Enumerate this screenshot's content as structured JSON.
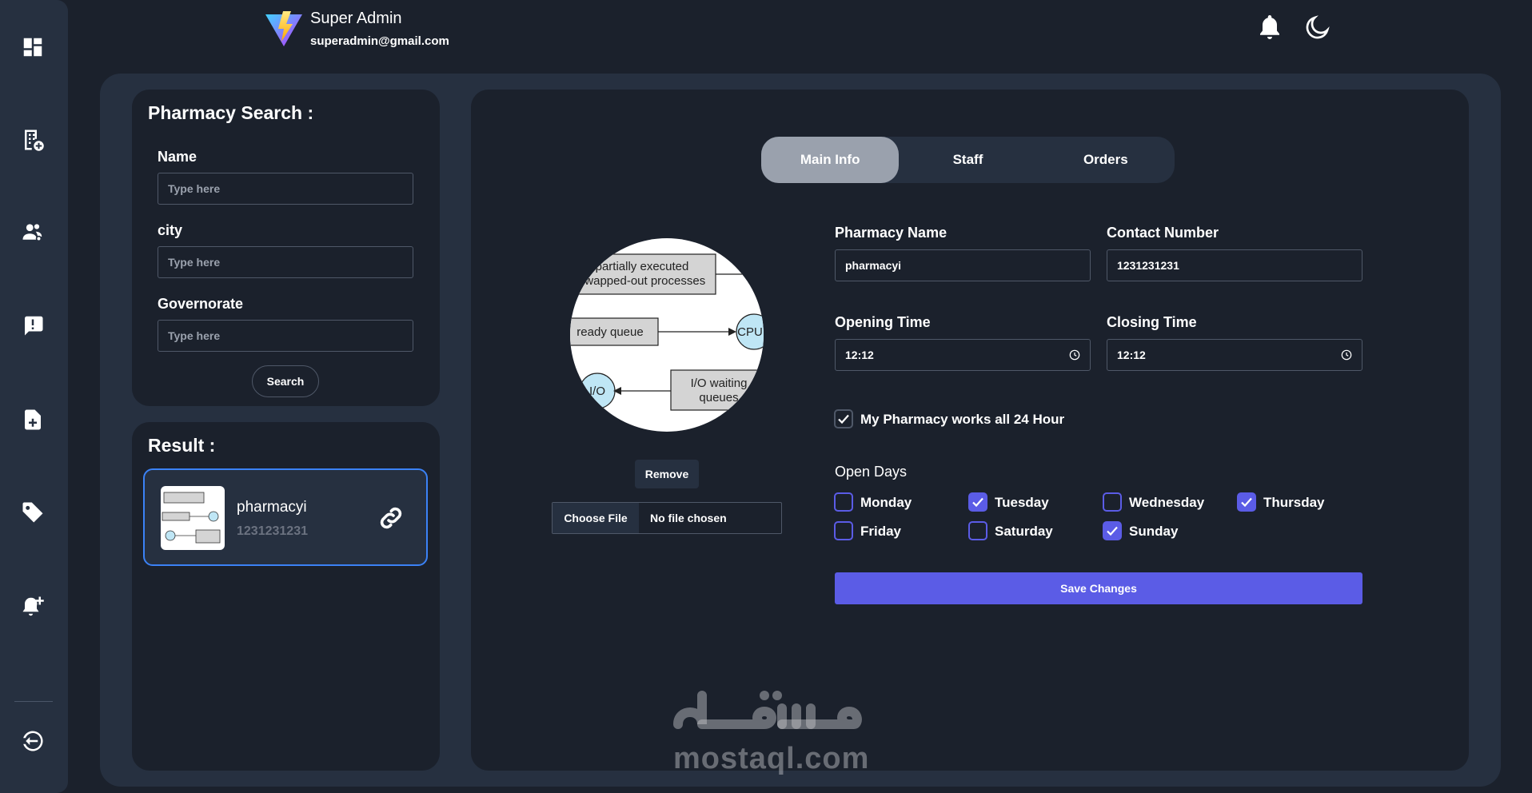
{
  "header": {
    "user_name": "Super Admin",
    "user_email": "superadmin@gmail.com"
  },
  "sidebar": {
    "icons": [
      "dashboard-icon",
      "pharmacy-building-icon",
      "users-settings-icon",
      "report-alert-icon",
      "file-add-icon",
      "tag-icon",
      "notification-add-icon",
      "logout-icon"
    ]
  },
  "search": {
    "title": "Pharmacy Search :",
    "name_label": "Name",
    "name_placeholder": "Type here",
    "city_label": "city",
    "city_placeholder": "Type here",
    "governorate_label": "Governorate",
    "governorate_placeholder": "Type here",
    "button": "Search"
  },
  "result": {
    "title": "Result :",
    "item": {
      "name": "pharmacyi",
      "phone": "1231231231"
    }
  },
  "tabs": [
    {
      "label": "Main Info",
      "active": true
    },
    {
      "label": "Staff",
      "active": false
    },
    {
      "label": "Orders",
      "active": false
    }
  ],
  "image": {
    "diagram_texts": {
      "t1": "partially executed",
      "t2": "swapped-out processes",
      "t3": "ready queue",
      "t4": "CPU",
      "t5": "I/O",
      "t6": "I/O waiting",
      "t7": "queues"
    },
    "remove_label": "Remove",
    "choose_file_label": "Choose File",
    "no_file_label": "No file chosen"
  },
  "form": {
    "pharmacy_name_label": "Pharmacy Name",
    "pharmacy_name_value": "pharmacyi",
    "contact_label": "Contact Number",
    "contact_value": "1231231231",
    "opening_label": "Opening Time",
    "opening_value": "12:12",
    "closing_label": "Closing Time",
    "closing_value": "12:12",
    "all_day_label": "My Pharmacy works all 24 Hour",
    "all_day_checked": true,
    "open_days_label": "Open Days",
    "days": [
      {
        "label": "Monday",
        "checked": false
      },
      {
        "label": "Tuesday",
        "checked": true
      },
      {
        "label": "Wednesday",
        "checked": false
      },
      {
        "label": "Thursday",
        "checked": true
      },
      {
        "label": "Friday",
        "checked": false
      },
      {
        "label": "Saturday",
        "checked": false
      },
      {
        "label": "Sunday",
        "checked": true
      }
    ],
    "save_label": "Save Changes"
  },
  "watermark": {
    "latin": "mostaql.com"
  },
  "colors": {
    "background": "#1b212c",
    "surface": "#263040",
    "accent": "#5b5ce6",
    "selected_border": "#3b82f6",
    "tab_active": "#9aa1ad"
  }
}
